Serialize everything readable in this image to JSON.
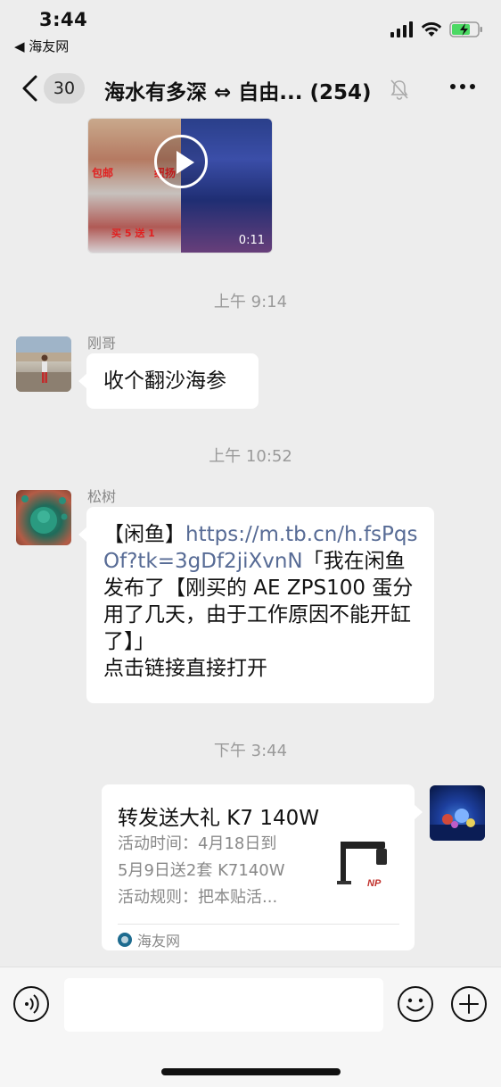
{
  "status_bar": {
    "time": "3:44",
    "back_app": "◀ 海友网"
  },
  "nav": {
    "unread_count": "30",
    "title": "海水有多深 ⇔ 自由...",
    "member_count": "(254)"
  },
  "messages": {
    "video": {
      "duration": "0:11",
      "tag_left": "包邮",
      "tag_right": "纽扬",
      "caption": "买 5 送 1"
    },
    "ts1": "上午 9:14",
    "m1": {
      "sender": "刚哥",
      "text": "收个翻沙海参"
    },
    "ts2": "上午 10:52",
    "m2": {
      "sender": "松树",
      "prefix": "【闲鱼】",
      "link": "https://m.tb.cn/h.fsPqsOf?tk=3gDf2jiXvnN",
      "line_a": "「我在闲鱼发布了【刚买的 AE ZPS100 蛋分用了几天，由于工作原因不能开缸了】」",
      "line_b": "点击链接直接打开"
    },
    "ts3": "下午 3:44",
    "card": {
      "title": "转发送大礼 K7 140W",
      "desc_1": "活动时间：4月18日到",
      "desc_2": "5月9日送2套 K7140W",
      "desc_3": "活动规则：把本贴活...",
      "source": "海友网",
      "thumb_logo": "NP"
    }
  },
  "input": {
    "placeholder": ""
  },
  "colors": {
    "background": "#ededed",
    "link": "#576b95",
    "bubble": "#ffffff",
    "timestamp": "#9a9a9a"
  }
}
